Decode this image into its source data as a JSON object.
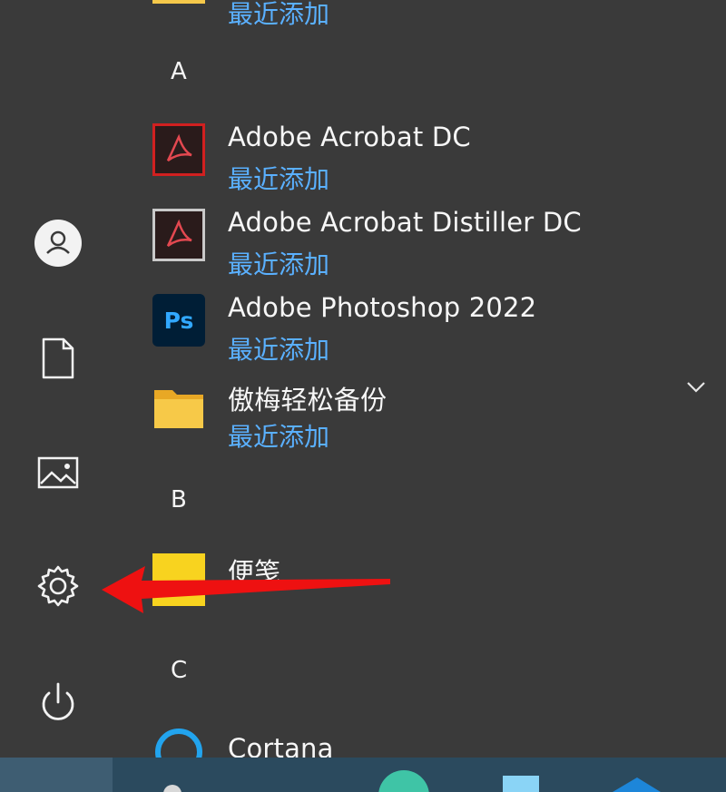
{
  "icons": {
    "user": "user-icon",
    "documents": "documents-icon",
    "pictures": "pictures-icon",
    "settings": "settings-icon",
    "power": "power-icon"
  },
  "list": {
    "top_partial_subtitle": "最近添加",
    "sections": [
      {
        "letter": "A",
        "apps": [
          {
            "name": "Adobe Acrobat DC",
            "subtitle": "最近添加",
            "icon": "acrobat-icon"
          },
          {
            "name": "Adobe Acrobat Distiller DC",
            "subtitle": "最近添加",
            "icon": "acrobat-distiller-icon"
          },
          {
            "name": "Adobe Photoshop 2022",
            "subtitle": "最近添加",
            "icon": "photoshop-icon",
            "icon_text": "Ps"
          },
          {
            "name": "傲梅轻松备份",
            "subtitle": "最近添加",
            "icon": "folder-icon",
            "expandable": true
          }
        ]
      },
      {
        "letter": "B",
        "apps": [
          {
            "name": "便笺",
            "icon": "sticky-notes-icon"
          }
        ]
      },
      {
        "letter": "C",
        "apps": [
          {
            "name": "Cortana",
            "icon": "cortana-icon"
          }
        ]
      }
    ]
  },
  "annotation": {
    "arrow_color": "#ee1111",
    "points_to": "settings-icon"
  },
  "colors": {
    "background": "#3a3a3a",
    "accent_text": "#5ab0ff",
    "taskbar": "#2b4a5e"
  }
}
